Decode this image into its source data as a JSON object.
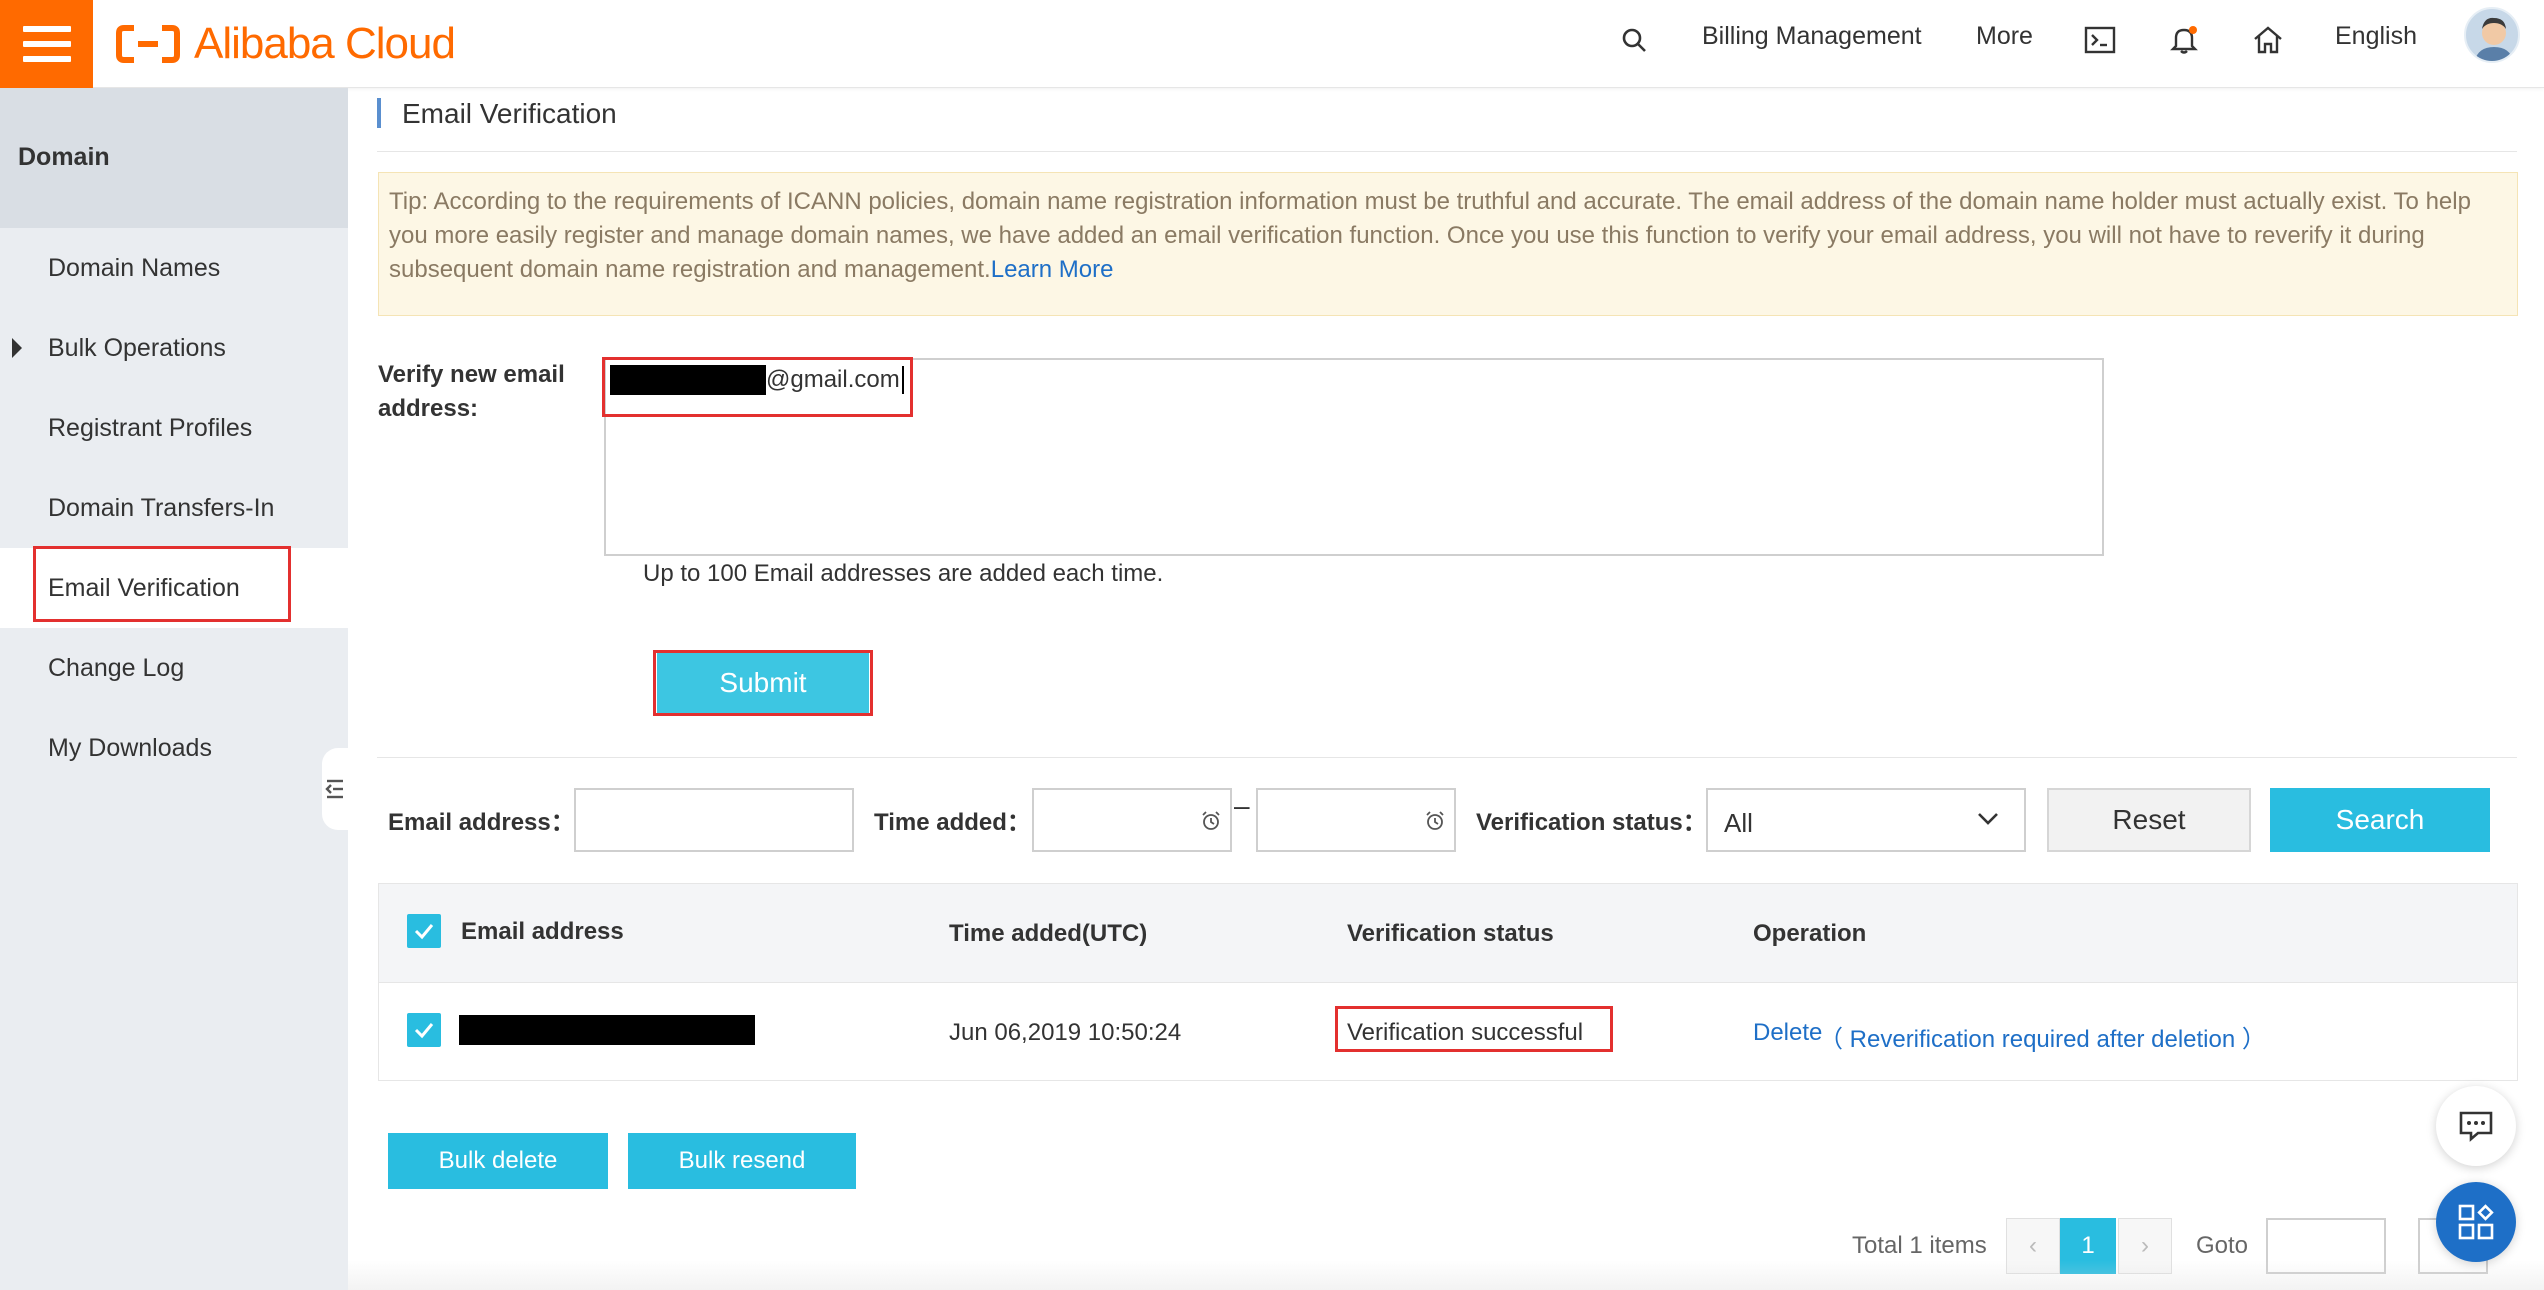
{
  "header": {
    "brand": "Alibaba Cloud",
    "nav": {
      "billing": "Billing Management",
      "more": "More",
      "language": "English"
    },
    "icons": [
      "menu-icon",
      "search-icon",
      "terminal-icon",
      "bell-icon",
      "home-icon",
      "avatar"
    ]
  },
  "sidebar": {
    "title": "Domain",
    "items": [
      {
        "label": "Domain Names"
      },
      {
        "label": "Bulk Operations"
      },
      {
        "label": "Registrant Profiles"
      },
      {
        "label": "Domain Transfers-In"
      },
      {
        "label": "Email Verification"
      },
      {
        "label": "Change Log"
      },
      {
        "label": "My Downloads"
      }
    ],
    "active_item": "Email Verification"
  },
  "main": {
    "title": "Email Verification",
    "tip": {
      "text": "Tip: According to the requirements of ICANN policies, domain name registration information must be truthful and accurate. The email address of the domain name holder must actually exist. To help you more easily register and manage domain names, we have added an email verification function. Once you use this function to verify your email address, you will not have to reverify it during subsequent domain name registration and management.",
      "link": "Learn More"
    },
    "verify_form": {
      "label": "Verify new email address:",
      "value_suffix": "@gmail.com",
      "hint": "Up to 100 Email addresses are added each time.",
      "submit": "Submit"
    },
    "filters": {
      "email_label": "Email address：",
      "time_label": "Time added：",
      "range_separator": "–",
      "status_label": "Verification status：",
      "status_value": "All",
      "reset": "Reset",
      "search": "Search"
    },
    "table": {
      "columns": [
        "Email address",
        "Time added(UTC)",
        "Verification status",
        "Operation"
      ],
      "rows": [
        {
          "time_added": "Jun 06,2019 10:50:24",
          "status": "Verification successful",
          "operation_delete": "Delete",
          "operation_note": "（ Reverification required after deletion ）"
        }
      ]
    },
    "bulk": {
      "delete": "Bulk delete",
      "resend": "Bulk resend"
    },
    "pagination": {
      "total": "Total 1 items",
      "prev": "‹",
      "current": "1",
      "next": "›",
      "goto": "Goto"
    }
  },
  "colors": {
    "brand_orange": "#ff6a00",
    "accent_cyan": "#29bde0",
    "link_blue": "#1e6fc7",
    "highlight_red": "#e3302f",
    "tip_background": "#fdf7e5"
  }
}
